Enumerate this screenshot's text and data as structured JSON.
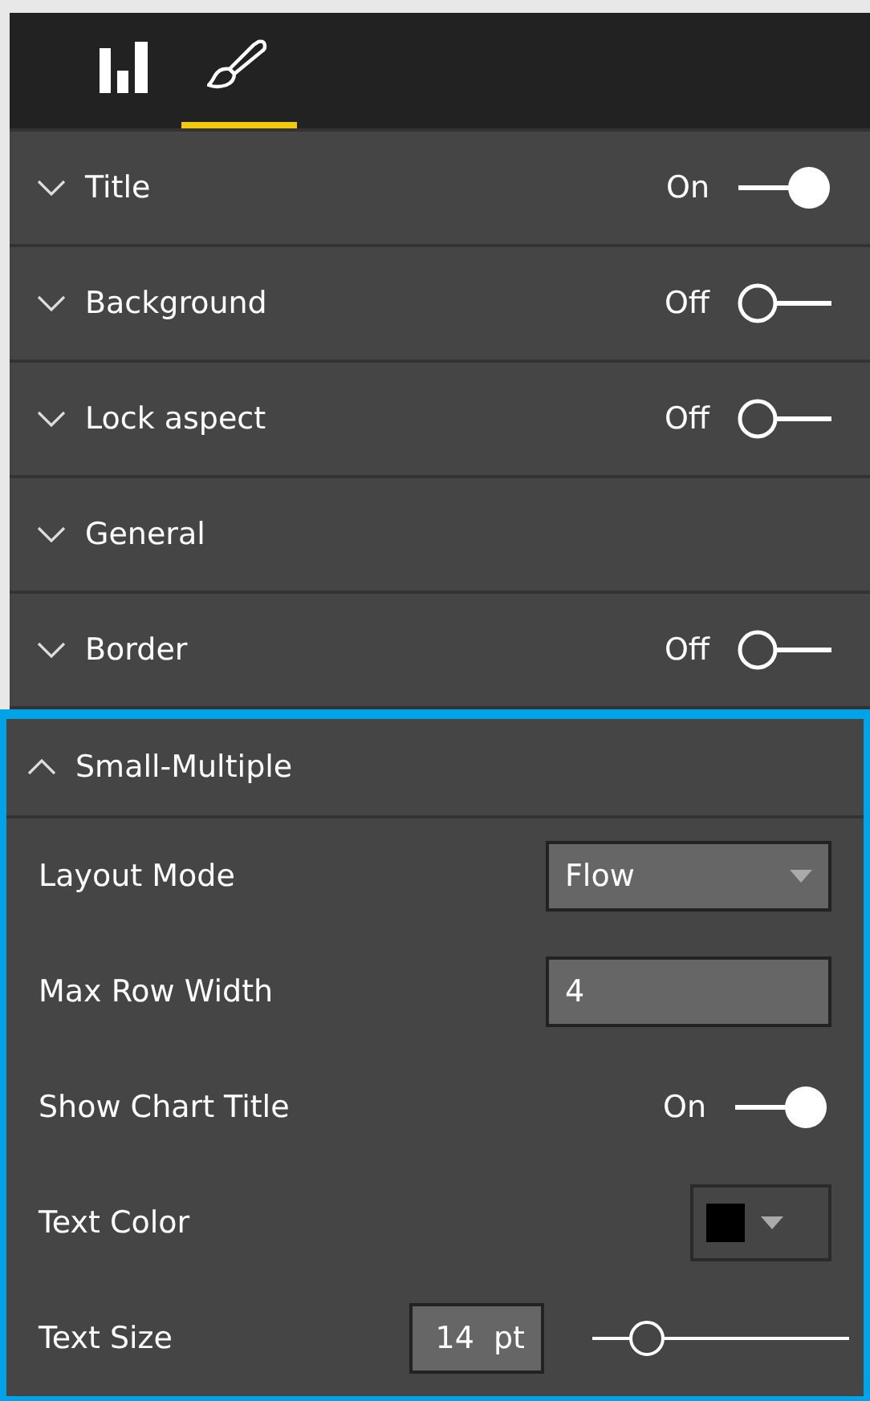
{
  "tabs": [
    {
      "kind": "fields",
      "selected": false
    },
    {
      "kind": "format",
      "selected": true
    }
  ],
  "sections": [
    {
      "label": "Title",
      "expanded": false,
      "toggle": {
        "on": true,
        "label": "On"
      }
    },
    {
      "label": "Background",
      "expanded": false,
      "toggle": {
        "on": false,
        "label": "Off"
      }
    },
    {
      "label": "Lock aspect",
      "expanded": false,
      "toggle": {
        "on": false,
        "label": "Off"
      }
    },
    {
      "label": "General",
      "expanded": false
    },
    {
      "label": "Border",
      "expanded": false,
      "toggle": {
        "on": false,
        "label": "Off"
      }
    },
    {
      "label": "Small-Multiple",
      "expanded": true,
      "focused": true,
      "settings": [
        {
          "kind": "dropdown",
          "label": "Layout Mode",
          "value": "Flow"
        },
        {
          "kind": "number",
          "label": "Max Row Width",
          "value": "4"
        },
        {
          "kind": "toggle",
          "label": "Show Chart Title",
          "on": true,
          "state": "On"
        },
        {
          "kind": "color",
          "label": "Text Color",
          "color": "#000000"
        },
        {
          "kind": "size",
          "label": "Text Size",
          "value": "14",
          "unit": "pt",
          "level": 0.2
        }
      ]
    }
  ]
}
